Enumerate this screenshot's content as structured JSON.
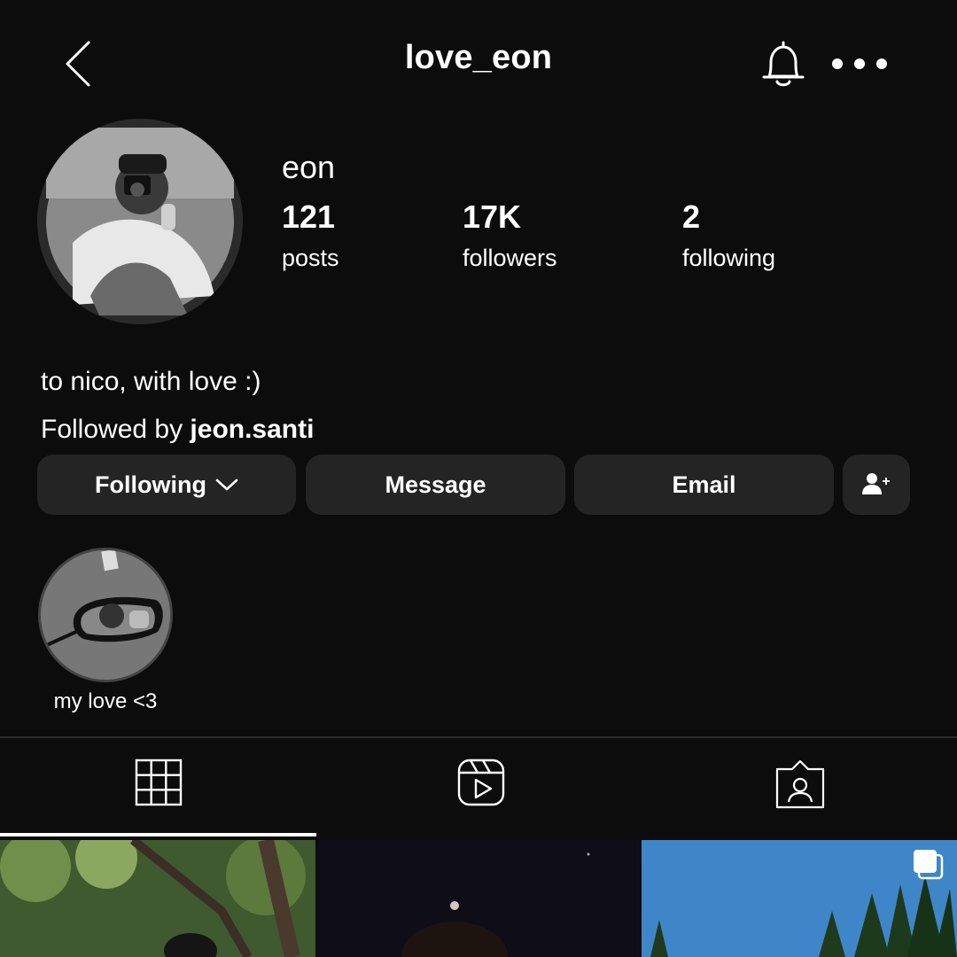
{
  "header": {
    "title": "love_eon",
    "back_icon": "chevron-left-icon",
    "bell_icon": "bell-icon",
    "more_icon": "more-horizontal-icon"
  },
  "profile": {
    "display_name": "eon",
    "stats": [
      {
        "value": "121",
        "label": "posts"
      },
      {
        "value": "17K",
        "label": "followers"
      },
      {
        "value": "2",
        "label": "following"
      }
    ],
    "bio": "to nico, with love :)",
    "followed_by_prefix": "Followed by ",
    "followed_by_user": "jeon.santi"
  },
  "actions": {
    "following_label": "Following",
    "message_label": "Message",
    "email_label": "Email",
    "add_person_icon": "person-add-icon"
  },
  "highlights": [
    {
      "label": "my love <3"
    }
  ],
  "tabs": [
    {
      "name": "grid-icon",
      "active": true
    },
    {
      "name": "reels-icon",
      "active": false
    },
    {
      "name": "tagged-icon",
      "active": false
    }
  ],
  "colors": {
    "background": "#0c0c0d",
    "button": "#242425",
    "text": "#ffffff"
  }
}
